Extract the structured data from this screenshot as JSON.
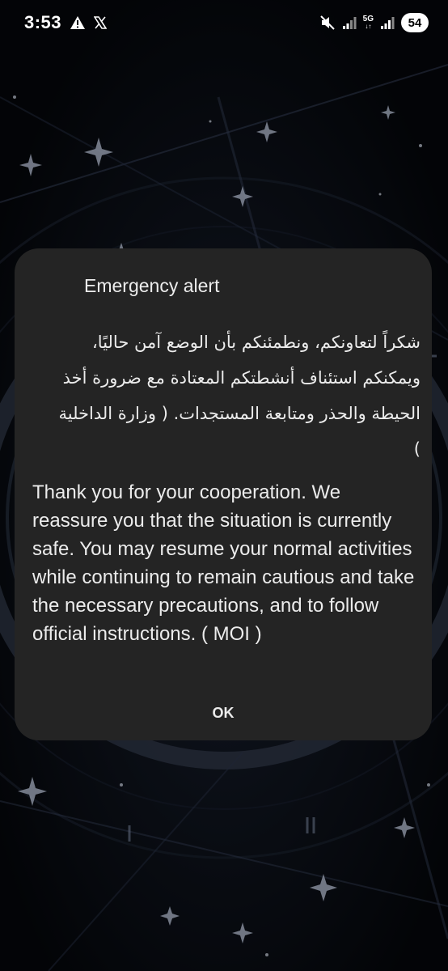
{
  "status_bar": {
    "time": "3:53",
    "network_label": "5G",
    "network_arrows": "↓↑",
    "battery": "54",
    "icons": [
      "warning-icon",
      "x-logo-icon",
      "muted-icon",
      "signal-icon",
      "signal-icon-2"
    ]
  },
  "dialog": {
    "title": "Emergency alert",
    "arabic_message": "شكراً لتعاونكم، ونطمئنكم بأن الوضع آمن حاليًا، ويمكنكم استئناف أنشطتكم المعتادة مع ضرورة أخذ الحيطة والحذر ومتابعة المستجدات. ( وزارة الداخلية )",
    "english_message": "Thank you for your cooperation. We reassure you that the situation is currently safe. You may resume your normal activities while continuing to remain cautious and take the necessary precautions, and to follow official instructions. ( MOI  )",
    "ok_label": "OK"
  },
  "colors": {
    "dialog_background": "#242424",
    "wallpaper": "#0a0d14",
    "text": "#ececec"
  }
}
